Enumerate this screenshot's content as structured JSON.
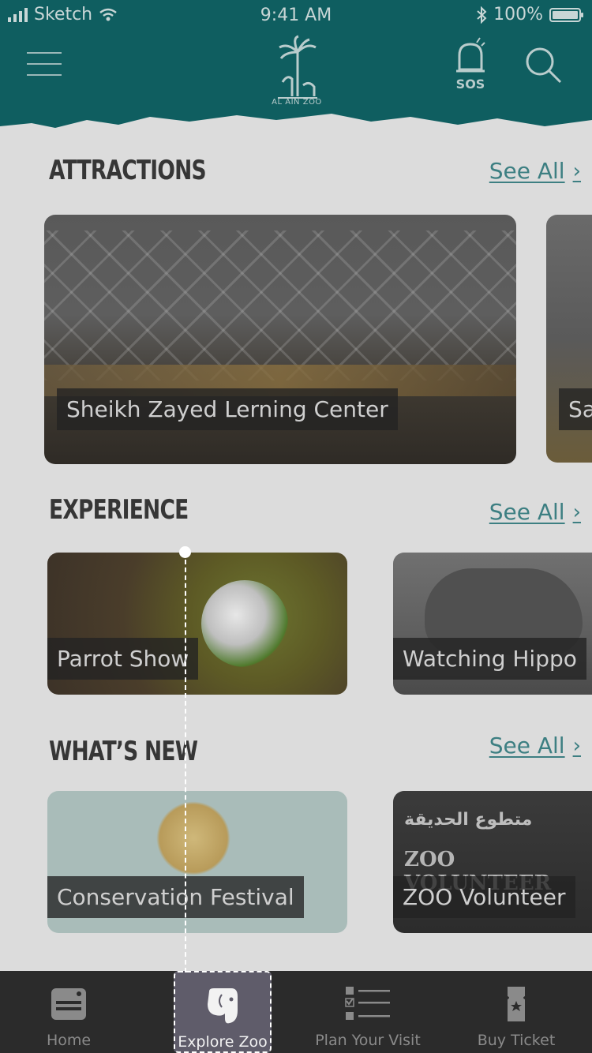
{
  "status_bar": {
    "carrier": "Sketch",
    "time": "9:41 AM",
    "battery": "100%",
    "battery_level": 1.0
  },
  "header": {
    "logo_text": "AL AIN ZOO",
    "sos_label": "SOS",
    "icons": {
      "menu": "hamburger-icon",
      "sos": "alarm-siren-icon",
      "search": "search-icon"
    }
  },
  "attractions": {
    "title": "ATTRACTIONS",
    "see_all": "See All",
    "cards": [
      {
        "caption": "Sheikh Zayed Lerning Center"
      },
      {
        "caption": "Sa"
      }
    ]
  },
  "experience": {
    "title": "EXPERIENCE",
    "see_all": "See All",
    "cards": [
      {
        "caption": "Parrot Show"
      },
      {
        "caption": "Watching Hippo"
      }
    ]
  },
  "whats_new": {
    "title": "WHAT’S NEW",
    "see_all": "See All",
    "cards": [
      {
        "caption": "Conservation Festival"
      },
      {
        "caption": "ZOO Volunteer",
        "poster_arabic": "متطوع الحديقة",
        "poster_english": "ZOO VOLUNTEER"
      }
    ]
  },
  "tabbar": {
    "tabs": [
      {
        "label": "Home",
        "icon": "home-card-icon",
        "active": false
      },
      {
        "label": "Explore Zoo",
        "icon": "elephant-icon",
        "active": true
      },
      {
        "label": "Plan Your Visit",
        "icon": "checklist-icon",
        "active": false
      },
      {
        "label": "Buy Ticket",
        "icon": "ticket-icon",
        "active": false
      }
    ]
  },
  "colors": {
    "header": "#0f5e60",
    "accent_link": "#3d7f82",
    "tabbar": "#2b2b2b",
    "active_tab": "#5f5c6a"
  }
}
